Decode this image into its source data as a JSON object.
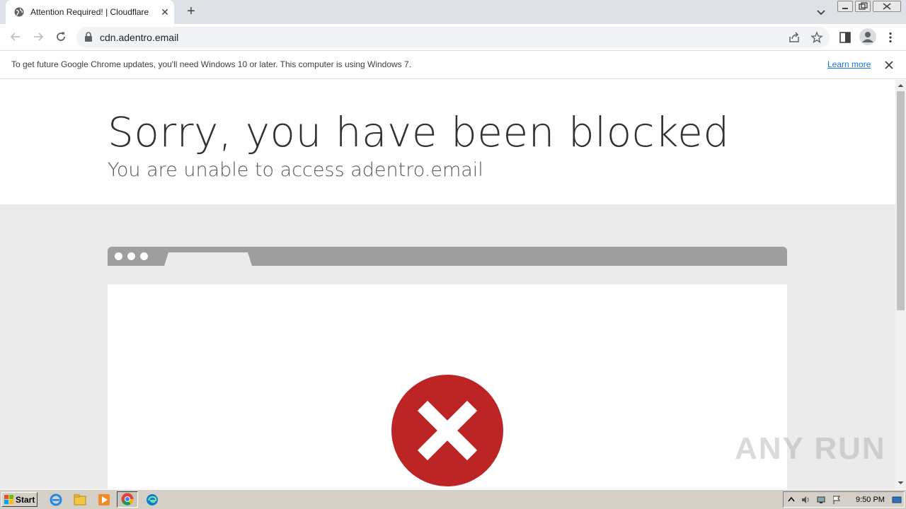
{
  "browser": {
    "tab_title": "Attention Required! | Cloudflare",
    "url": "cdn.adentro.email"
  },
  "infobar": {
    "message": "To get future Google Chrome updates, you'll need Windows 10 or later. This computer is using Windows 7.",
    "learn_more": "Learn more"
  },
  "page": {
    "title": "Sorry, you have been blocked",
    "subtitle": "You are unable to access adentro.email"
  },
  "watermark": "ANY RUN",
  "taskbar": {
    "start_label": "Start",
    "clock": "9:50 PM"
  },
  "colors": {
    "error_red": "#bd2426",
    "link_blue": "#1a73e8",
    "tabstrip": "#dee1e6"
  }
}
